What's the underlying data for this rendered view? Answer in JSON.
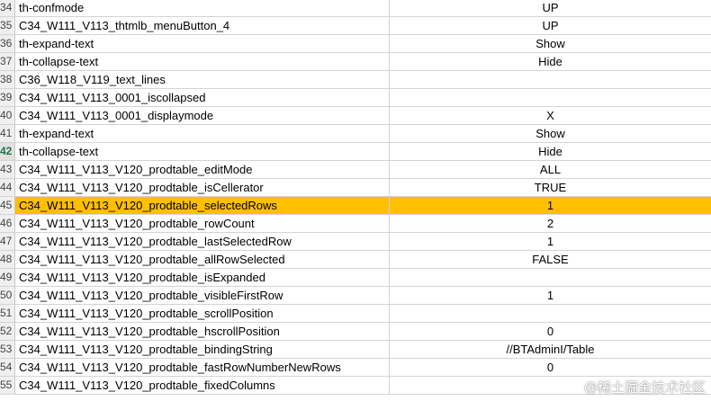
{
  "spreadsheet": {
    "rows": [
      {
        "num": "34",
        "name": "th-confmode",
        "value": "UP"
      },
      {
        "num": "35",
        "name": "C34_W111_V113_thtmlb_menuButton_4",
        "value": "UP"
      },
      {
        "num": "36",
        "name": "th-expand-text",
        "value": "Show"
      },
      {
        "num": "37",
        "name": "th-collapse-text",
        "value": "Hide"
      },
      {
        "num": "38",
        "name": "C36_W118_V119_text_lines",
        "value": ""
      },
      {
        "num": "39",
        "name": "C34_W111_V113_0001_iscollapsed",
        "value": ""
      },
      {
        "num": "40",
        "name": "C34_W111_V113_0001_displaymode",
        "value": "X"
      },
      {
        "num": "41",
        "name": "th-expand-text",
        "value": "Show"
      },
      {
        "num": "42",
        "name": "th-collapse-text",
        "value": "Hide"
      },
      {
        "num": "43",
        "name": "C34_W111_V113_V120_prodtable_editMode",
        "value": "ALL"
      },
      {
        "num": "44",
        "name": "C34_W111_V113_V120_prodtable_isCellerator",
        "value": "TRUE"
      },
      {
        "num": "45",
        "name": "C34_W111_V113_V120_prodtable_selectedRows",
        "value": "1"
      },
      {
        "num": "46",
        "name": "C34_W111_V113_V120_prodtable_rowCount",
        "value": "2"
      },
      {
        "num": "47",
        "name": "C34_W111_V113_V120_prodtable_lastSelectedRow",
        "value": "1"
      },
      {
        "num": "48",
        "name": "C34_W111_V113_V120_prodtable_allRowSelected",
        "value": "FALSE"
      },
      {
        "num": "49",
        "name": "C34_W111_V113_V120_prodtable_isExpanded",
        "value": ""
      },
      {
        "num": "50",
        "name": "C34_W111_V113_V120_prodtable_visibleFirstRow",
        "value": "1"
      },
      {
        "num": "51",
        "name": "C34_W111_V113_V120_prodtable_scrollPosition",
        "value": ""
      },
      {
        "num": "52",
        "name": "C34_W111_V113_V120_prodtable_hscrollPosition",
        "value": "0"
      },
      {
        "num": "53",
        "name": "C34_W111_V113_V120_prodtable_bindingString",
        "value": "//BTAdminI/Table"
      },
      {
        "num": "54",
        "name": "C34_W111_V113_V120_prodtable_fastRowNumberNewRows",
        "value": "0"
      },
      {
        "num": "55",
        "name": "C34_W111_V113_V120_prodtable_fixedColumns",
        "value": ""
      }
    ]
  },
  "highlight": {
    "selected_row_number": "45",
    "active_row_number": "42",
    "selected_color": "#ffc000"
  },
  "watermark": {
    "text": "@稀土掘金技术社区"
  }
}
